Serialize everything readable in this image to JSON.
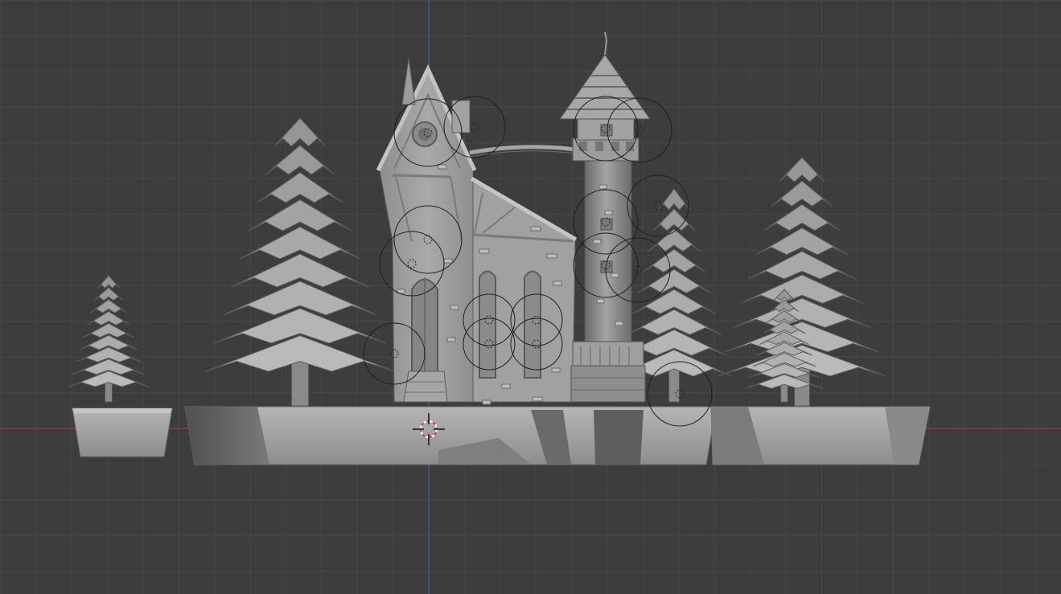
{
  "viewport": {
    "view": "front-orthographic",
    "shading": "solid",
    "background_color": "#3d3d3d",
    "grid_color": "#484848",
    "axis_x_color": "#a8423f",
    "axis_z_color": "#3f6ea8",
    "model_color": "#9a9a9a",
    "light_probe_color": "#1e1e1e",
    "cursor_icon": "3d-cursor-icon",
    "scene_objects": [
      "pine-tree-small-left",
      "pine-tree-large-left",
      "half-timbered-house",
      "stone-tower",
      "pine-tree-behind-tower",
      "pine-tree-large-right",
      "pine-tree-small-right",
      "ground-base-left",
      "ground-base-main",
      "ground-base-right"
    ]
  }
}
